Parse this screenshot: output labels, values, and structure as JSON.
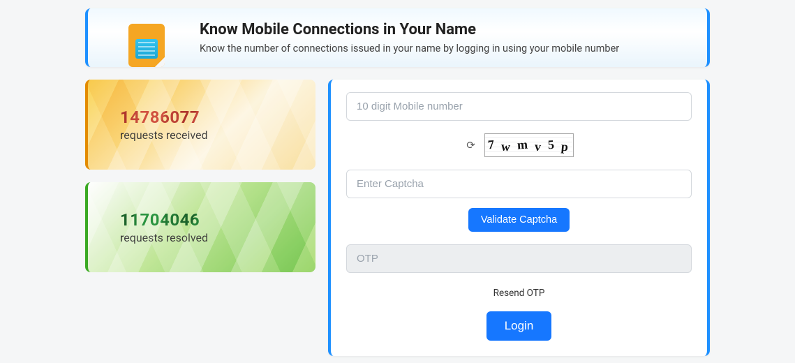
{
  "hero": {
    "title": "Know Mobile Connections in Your Name",
    "subtitle": "Know the number of connections issued in your name by logging in using your mobile number"
  },
  "stats": {
    "received_count": "14786077",
    "received_label": "requests received",
    "resolved_count": "11704046",
    "resolved_label": "requests resolved"
  },
  "form": {
    "mobile_placeholder": "10 digit Mobile number",
    "captcha_chars": [
      "7",
      "w",
      "m",
      "v",
      "5",
      "p"
    ],
    "captcha_placeholder": "Enter Captcha",
    "validate_label": "Validate Captcha",
    "otp_placeholder": "OTP",
    "resend_label": "Resend OTP",
    "login_label": "Login"
  }
}
